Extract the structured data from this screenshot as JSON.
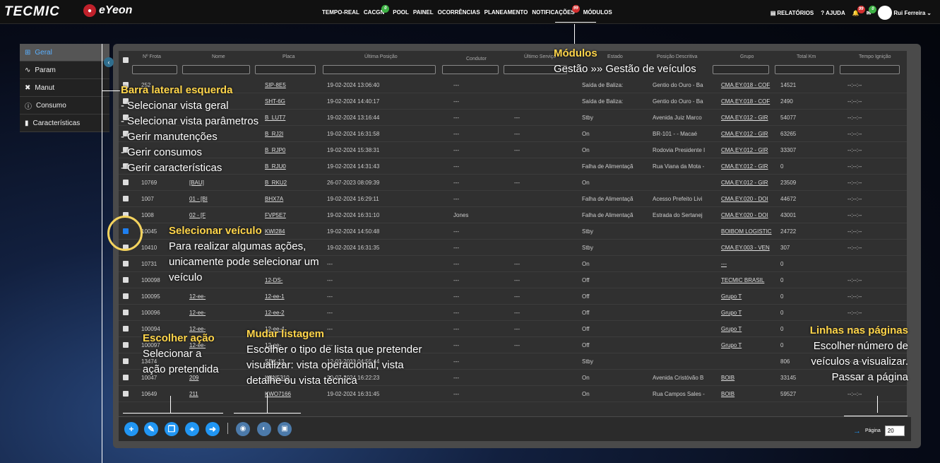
{
  "header": {
    "logo": "TECMIC",
    "product": "eYeon",
    "nav": [
      {
        "label": "TEMPO-REAL"
      },
      {
        "label": "CACGN",
        "badge": "0"
      },
      {
        "label": "POOL"
      },
      {
        "label": "PAINEL"
      },
      {
        "label": "OCORRÊNCIAS"
      },
      {
        "label": "PLANEAMENTO"
      },
      {
        "label": "NOTIFICAÇÕES",
        "badge": "99"
      },
      {
        "label": "MÓDULOS"
      }
    ],
    "reports": "RELATÓRIOS",
    "help": "AJUDA",
    "bell_badge": "99",
    "mail_badge": "0",
    "user": "Rui Ferreira"
  },
  "sidebar": {
    "items": [
      {
        "label": "Geral",
        "icon": "grid-icon"
      },
      {
        "label": "Param",
        "icon": "wave-icon"
      },
      {
        "label": "Manut",
        "icon": "tools-icon"
      },
      {
        "label": "Consumo",
        "icon": "info-icon"
      },
      {
        "label": "Características",
        "icon": "document-icon"
      }
    ]
  },
  "table": {
    "columns": [
      "Nº Frota",
      "Nome",
      "Placa",
      "Última Posição",
      "Condutor",
      "Último Serviço",
      "Estado",
      "Posição Descritiva",
      "Grupo",
      "Total Km",
      "Tempo Ignição"
    ],
    "rows": [
      {
        "frota": "252",
        "nome": "",
        "placa": "SIP-8E5",
        "pos": "19-02-2024 13:06:40",
        "cond": "---",
        "serv": "",
        "estado": "Saída de Baliza:",
        "desc": "Gentio do Ouro - Ba",
        "grupo": "CMA.EY.018 - COF",
        "km": "14521",
        "ign": "--:--:--",
        "checked": false
      },
      {
        "frota": "",
        "nome": "",
        "placa": "SHT-6G",
        "pos": "19-02-2024 14:40:17",
        "cond": "---",
        "serv": "",
        "estado": "Saída de Baliza:",
        "desc": "Gentio do Ouro - Ba",
        "grupo": "CMA.EY.018 - COF",
        "km": "2490",
        "ign": "--:--:--",
        "checked": false
      },
      {
        "frota": "",
        "nome": "",
        "placa": "B_LUT7",
        "pos": "19-02-2024 13:16:44",
        "cond": "---",
        "serv": "---",
        "estado": "Stby",
        "desc": "Avenida Juiz Marco",
        "grupo": "CMA.EY.012 - GIR",
        "km": "54077",
        "ign": "--:--:--",
        "checked": false
      },
      {
        "frota": "",
        "nome": "",
        "placa": "B_RJ2I",
        "pos": "19-02-2024 16:31:58",
        "cond": "---",
        "serv": "---",
        "estado": "On",
        "desc": "BR-101 - - Macaé",
        "grupo": "CMA.EY.012 - GIR",
        "km": "63265",
        "ign": "--:--:--",
        "checked": false
      },
      {
        "frota": "",
        "nome": "",
        "placa": "B_RJP0",
        "pos": "19-02-2024 15:38:31",
        "cond": "---",
        "serv": "---",
        "estado": "On",
        "desc": "Rodovia Presidente I",
        "grupo": "CMA.EY.012 - GIR",
        "km": "33307",
        "ign": "--:--:--",
        "checked": false
      },
      {
        "frota": "",
        "nome": "",
        "placa": "B_RJU0",
        "pos": "19-02-2024 14:31:43",
        "cond": "---",
        "serv": "",
        "estado": "Falha de Alimentaçã",
        "desc": "Rua Viana da Mota -",
        "grupo": "CMA.EY.012 - GIR",
        "km": "0",
        "ign": "--:--:--",
        "checked": false
      },
      {
        "frota": "10769",
        "nome": "[BAU]",
        "placa": "B_RKU2",
        "pos": "26-07-2023 08:09:39",
        "cond": "---",
        "serv": "---",
        "estado": "On",
        "desc": "",
        "grupo": "CMA.EY.012 - GIR",
        "km": "23509",
        "ign": "--:--:--",
        "checked": false
      },
      {
        "frota": "1007",
        "nome": "01 - [BI",
        "placa": "BHX7A",
        "pos": "19-02-2024 16:29:11",
        "cond": "---",
        "serv": "",
        "estado": "Falha de Alimentaçã",
        "desc": "Acesso Prefeito Livi",
        "grupo": "CMA.EY.020 - DOI",
        "km": "44672",
        "ign": "--:--:--",
        "checked": false
      },
      {
        "frota": "1008",
        "nome": "02 - [F",
        "placa": "FVP5E7",
        "pos": "19-02-2024 16:31:10",
        "cond": "Jones",
        "serv": "",
        "estado": "Falha de Alimentaçã",
        "desc": "Estrada do Sertanej",
        "grupo": "CMA.EY.020 - DOI",
        "km": "43001",
        "ign": "--:--:--",
        "checked": false
      },
      {
        "frota": "10045",
        "nome": "",
        "placa": "KWI284",
        "pos": "19-02-2024 14:50:48",
        "cond": "---",
        "serv": "",
        "estado": "Stby",
        "desc": "",
        "grupo": "BOIBOM LOGISTIC",
        "km": "24722",
        "ign": "--:--:--",
        "checked": true
      },
      {
        "frota": "10410",
        "nome": "",
        "placa": "",
        "pos": "19-02-2024 16:31:35",
        "cond": "---",
        "serv": "",
        "estado": "Stby",
        "desc": "",
        "grupo": "CMA.EY.003 - VEN",
        "km": "307",
        "ign": "--:--:--",
        "checked": false
      },
      {
        "frota": "10731",
        "nome": "",
        "placa": "",
        "pos": "---",
        "cond": "---",
        "serv": "---",
        "estado": "On",
        "desc": "",
        "grupo": "---",
        "km": "0",
        "ign": "",
        "checked": false
      },
      {
        "frota": "100098",
        "nome": "",
        "placa": "12-DS-",
        "pos": "---",
        "cond": "---",
        "serv": "---",
        "estado": "Off",
        "desc": "",
        "grupo": "TECMIC BRASIL",
        "km": "0",
        "ign": "--:--:--",
        "checked": false
      },
      {
        "frota": "100095",
        "nome": "12-ee-",
        "placa": "12-ee-1",
        "pos": "---",
        "cond": "---",
        "serv": "---",
        "estado": "Off",
        "desc": "",
        "grupo": "Grupo T",
        "km": "0",
        "ign": "--:--:--",
        "checked": false
      },
      {
        "frota": "100096",
        "nome": "12-ee-",
        "placa": "12-ee-2",
        "pos": "---",
        "cond": "---",
        "serv": "---",
        "estado": "Off",
        "desc": "",
        "grupo": "Grupo T",
        "km": "0",
        "ign": "--:--:--",
        "checked": false
      },
      {
        "frota": "100094",
        "nome": "12-ee-",
        "placa": "12-ee-4",
        "pos": "---",
        "cond": "---",
        "serv": "---",
        "estado": "Off",
        "desc": "",
        "grupo": "Grupo T",
        "km": "0",
        "ign": "--:--:--",
        "checked": false
      },
      {
        "frota": "100097",
        "nome": "12-ee-",
        "placa": "12-ee-",
        "pos": "---",
        "cond": "---",
        "serv": "---",
        "estado": "Off",
        "desc": "",
        "grupo": "Grupo T",
        "km": "0",
        "ign": "--:--:--",
        "checked": false
      },
      {
        "frota": "13474",
        "nome": "",
        "placa": "SBK-13",
        "pos": "12-03-2033 04:55:44",
        "cond": "---",
        "serv": "",
        "estado": "Stby",
        "desc": "",
        "grupo": "",
        "km": "806",
        "ign": "--:--:--",
        "checked": false
      },
      {
        "frota": "10047",
        "nome": "209",
        "placa": "KRN5310",
        "pos": "30-07-2024 16:22:23",
        "cond": "---",
        "serv": "",
        "estado": "On",
        "desc": "Avenida Cristóvão B",
        "grupo": "BOIB",
        "km": "33145",
        "ign": "--:--:--",
        "checked": false
      },
      {
        "frota": "10649",
        "nome": "211",
        "placa": "KWO7166",
        "pos": "19-02-2024 16:31:45",
        "cond": "---",
        "serv": "",
        "estado": "On",
        "desc": "Rua Campos Sales -",
        "grupo": "BOIB",
        "km": "59527",
        "ign": "--:--:--",
        "checked": false
      }
    ]
  },
  "pagination": {
    "label": "Página",
    "per_page": "20"
  },
  "annotations": {
    "modulos": {
      "title": "Módulos",
      "body": "Gestão »» Gestão de veículos"
    },
    "barra": {
      "title": "Barra lateral esquerda",
      "lines": [
        "- Selecionar vista geral",
        "- Selecionar vista parâmetros",
        "- Gerir manutenções",
        "- Gerir consumos",
        "- Gerir características"
      ]
    },
    "selecionar": {
      "title": "Selecionar veículo",
      "lines": [
        "Para realizar algumas ações,",
        "unicamente pode selecionar um",
        "veículo"
      ]
    },
    "acao": {
      "title": "Escolher ação",
      "lines": [
        "Selecionar a",
        "ação pretendida"
      ]
    },
    "listagem": {
      "title": "Mudar listagem",
      "lines": [
        "Escolher o tipo de lista que pretender",
        "visualizar: vista operacional, vista",
        "detalhe ou vista técnica"
      ]
    },
    "linhas": {
      "title": "Linhas nas páginas",
      "lines": [
        "Escolher número de",
        "veículos a visualizar.",
        "Passar a página"
      ]
    }
  }
}
